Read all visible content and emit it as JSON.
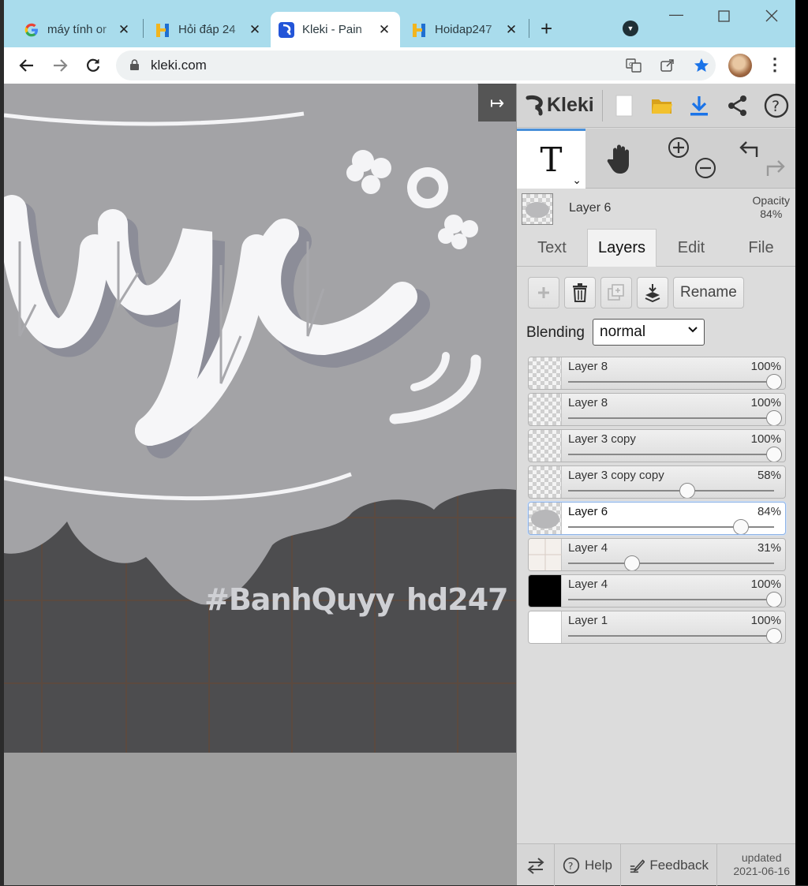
{
  "browser": {
    "tabs": [
      {
        "title": "máy tính or",
        "icon": "google-g-icon"
      },
      {
        "title": "Hỏi đáp 24",
        "icon": "hoidap-h-icon"
      },
      {
        "title": "Kleki - Pain",
        "icon": "kleki-icon",
        "active": true
      },
      {
        "title": "Hoidap247",
        "icon": "hoidap-h-icon"
      }
    ],
    "url": "kleki.com",
    "close_glyph": "✕",
    "new_tab_glyph": "+"
  },
  "canvas": {
    "watermark_left": "#BanhQuyy",
    "watermark_right": "hd247",
    "collapse_glyph": "↦"
  },
  "kleki": {
    "brand": "Kleki",
    "current_layer": {
      "name": "Layer 6",
      "opacity_label": "Opacity",
      "opacity_value": "84%"
    },
    "tabs": [
      "Text",
      "Layers",
      "Edit",
      "File"
    ],
    "active_tab": "Layers",
    "rename_label": "Rename",
    "blending_label": "Blending",
    "blending_value": "normal",
    "layers": [
      {
        "name": "Layer 8",
        "opacity_text": "100%",
        "opacity": 1.0,
        "thumb": "transparent"
      },
      {
        "name": "Layer 8",
        "opacity_text": "100%",
        "opacity": 1.0,
        "thumb": "transparent"
      },
      {
        "name": "Layer 3 copy",
        "opacity_text": "100%",
        "opacity": 1.0,
        "thumb": "transparent"
      },
      {
        "name": "Layer 3 copy copy",
        "opacity_text": "58%",
        "opacity": 0.58,
        "thumb": "transparent"
      },
      {
        "name": "Layer 6",
        "opacity_text": "84%",
        "opacity": 0.84,
        "thumb": "cloud",
        "selected": true
      },
      {
        "name": "Layer 4",
        "opacity_text": "31%",
        "opacity": 0.31,
        "thumb": "grid"
      },
      {
        "name": "Layer 4",
        "opacity_text": "100%",
        "opacity": 1.0,
        "thumb": "black"
      },
      {
        "name": "Layer 1",
        "opacity_text": "100%",
        "opacity": 1.0,
        "thumb": "white"
      }
    ],
    "footer": {
      "help": "Help",
      "feedback": "Feedback",
      "updated_label": "updated",
      "updated_date": "2021-06-16"
    }
  },
  "colors": {
    "tabbar": "#a9dcec",
    "accent_blue": "#1a73e8",
    "folder_yellow": "#f2c12e",
    "canvas_gray": "#a0a0a2",
    "grid_dark": "#4d4d4f"
  }
}
